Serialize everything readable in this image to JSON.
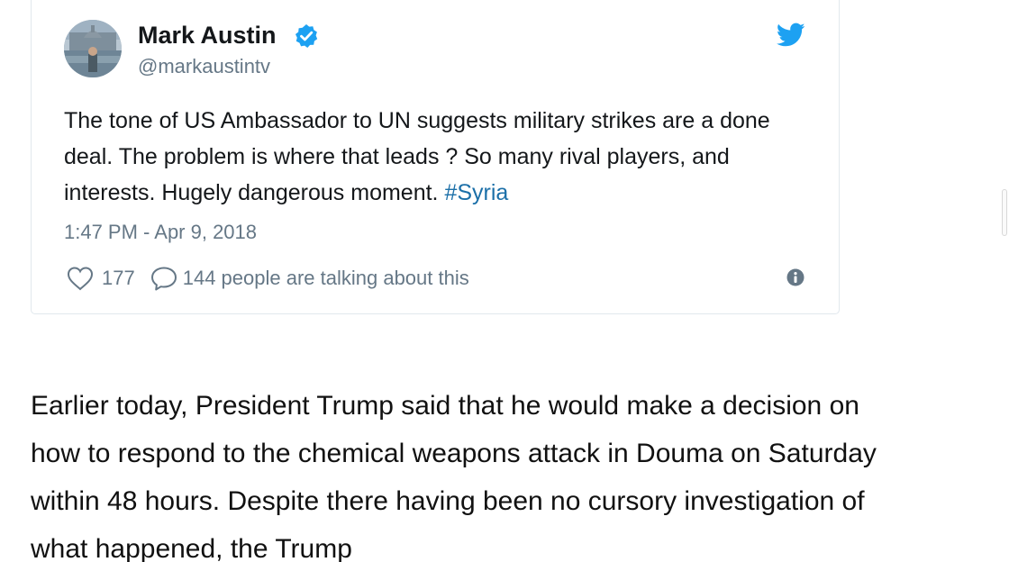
{
  "tweet": {
    "author_name": "Mark Austin",
    "handle": "@markaustintv",
    "text": "The tone of US Ambassador to UN suggests military strikes are a done deal. The problem is where that leads ? So many rival players, and interests. Hugely dangerous moment.",
    "hashtag": "#Syria",
    "timestamp": "1:47 PM - Apr 9, 2018",
    "like_count": "177",
    "talking_text": "144 people are talking about this",
    "verified": true
  },
  "article": {
    "paragraph": "Earlier today, President Trump said that he would make a decision on how to respond to the chemical weapons attack in Douma on Saturday within 48 hours. Despite there having been no cursory investigation of what happened, the Trump"
  },
  "colors": {
    "twitter_blue": "#1da1f2",
    "hashtag": "#1b6fa8",
    "secondary_text": "#657786",
    "primary_text": "#14171a",
    "card_border": "#e1e8ed"
  },
  "icons": {
    "verified": "verified-badge-icon",
    "twitter": "twitter-bird-icon",
    "like": "heart-icon",
    "reply": "speech-bubble-icon",
    "info": "info-icon"
  }
}
